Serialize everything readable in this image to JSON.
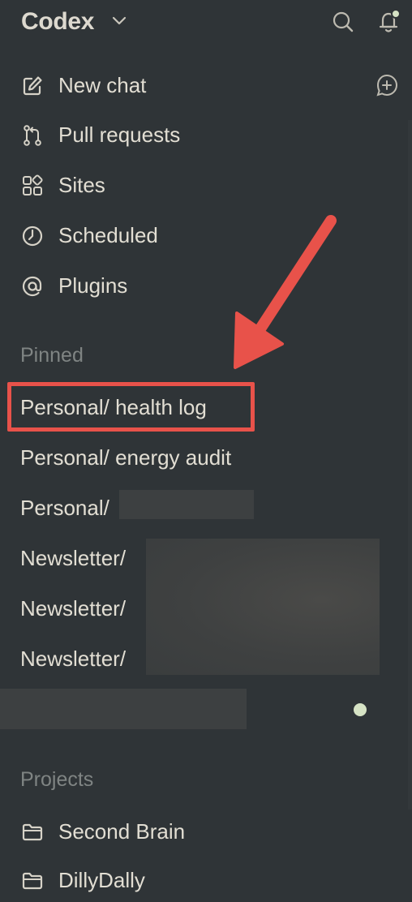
{
  "app": {
    "title": "Codex"
  },
  "nav": {
    "items": [
      {
        "label": "New chat",
        "icon": "new-chat-icon"
      },
      {
        "label": "Pull requests",
        "icon": "pull-request-icon"
      },
      {
        "label": "Sites",
        "icon": "sites-icon"
      },
      {
        "label": "Scheduled",
        "icon": "clock-icon"
      },
      {
        "label": "Plugins",
        "icon": "plugins-icon"
      }
    ]
  },
  "pinned": {
    "heading": "Pinned",
    "items": [
      {
        "label": "Personal/ health log"
      },
      {
        "label": "Personal/ energy audit"
      },
      {
        "label": "Personal/"
      },
      {
        "label": "Newsletter/"
      },
      {
        "label": "Newsletter/"
      },
      {
        "label": "Newsletter/"
      }
    ]
  },
  "projects": {
    "heading": "Projects",
    "items": [
      {
        "label": "Second Brain",
        "icon": "folder-icon"
      },
      {
        "label": "DillyDally",
        "icon": "folder-icon"
      }
    ]
  },
  "colors": {
    "background": "#2f3437",
    "text": "#e2ded3",
    "muted": "#7f8483",
    "annotation": "#e8524a",
    "notification_dot": "#d6e3c5"
  }
}
